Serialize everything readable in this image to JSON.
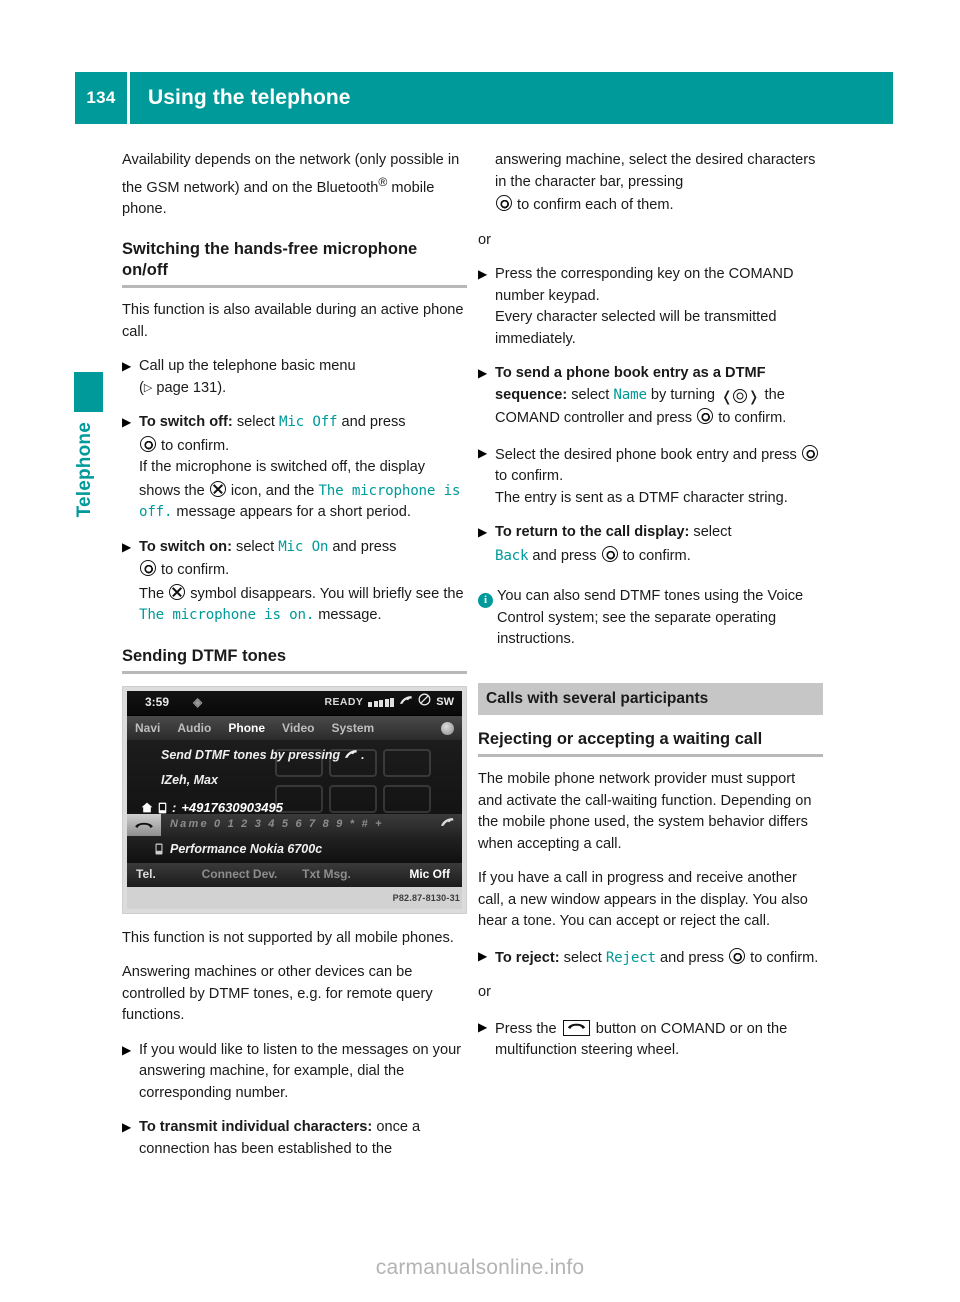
{
  "header": {
    "page_number": "134",
    "title": "Using the telephone"
  },
  "side_tab": {
    "label": "Telephone"
  },
  "left_column": {
    "intro_paragraph": "Availability depends on the network (only possible in the GSM network) and on the Bluetooth",
    "intro_paragraph_tail": " mobile phone.",
    "registered_mark": "®",
    "heading_mic": "Switching the hands-free microphone on/off",
    "mic_intro": "This function is also available during an active phone call.",
    "step_call_up": "Call up the telephone basic menu",
    "step_call_up_ref_open": "(",
    "step_call_up_ref": " page 131).",
    "step_switch_off_bold": "To switch off:",
    "step_switch_off_pre": " select ",
    "step_switch_off_code": "Mic Off",
    "step_switch_off_post": " and press ",
    "step_switch_off_confirm": " to confirm.",
    "switch_off_detail_1": "If the microphone is switched off, the display shows the ",
    "switch_off_detail_2": " icon, and the ",
    "switch_off_code_msg": "The microphone is off.",
    "switch_off_detail_3": " message appears for a short period.",
    "step_switch_on_bold": "To switch on:",
    "step_switch_on_pre": " select ",
    "step_switch_on_code": "Mic On",
    "step_switch_on_post": " and press ",
    "step_switch_on_confirm": " to confirm.",
    "switch_on_detail_1": "The ",
    "switch_on_detail_2": " symbol disappears. You will briefly see the ",
    "switch_on_code_msg": "The microphone is on.",
    "switch_on_detail_3": " message.",
    "heading_dtmf": "Sending DTMF tones",
    "after_shot_1": "This function is not supported by all mobile phones.",
    "after_shot_2": "Answering machines or other devices can be controlled by DTMF tones, e.g. for remote query functions.",
    "step_listen": "If you would like to listen to the messages on your answering machine, for example, dial the corresponding number.",
    "step_transmit_bold": "To transmit individual characters:",
    "step_transmit_rest": " once a connection has been established to the"
  },
  "comand_screenshot": {
    "status_time": "3:59",
    "status_globe_icon": "globe-icon",
    "status_ready": "READY",
    "status_signal_icon": "signal-bars-icon",
    "status_handset_icon": "handset-icon",
    "status_no_service_icon": "no-service-icon",
    "status_sw": "SW",
    "menu_items": [
      "Navi",
      "Audio",
      "Phone",
      "Video",
      "System"
    ],
    "menu_active": "Phone",
    "prompt_line": "Send DTMF tones by pressing",
    "prompt_line_end": ".",
    "contact_name": "IZeh, Max",
    "phone_number": "+4917630903495",
    "char_bar": "Name  0 1 2 3 4 5 6 7 8 9 * # +",
    "device_name": "Performance Nokia 6700c",
    "softkeys": [
      "Tel.",
      "Connect Dev.",
      "Txt Msg.",
      "Mic Off"
    ],
    "caption_code": "P82.87-8130-31"
  },
  "right_column": {
    "cont_1": "answering machine, select the desired characters in the character bar, pressing ",
    "cont_1_end": " to confirm each of them.",
    "or_1": "or",
    "step_press_key": "Press the corresponding key on the COMAND number keypad.",
    "step_press_key_detail": "Every character selected will be transmitted immediately.",
    "step_pb_bold": "To send a phone book entry as a DTMF sequence:",
    "step_pb_pre": " select ",
    "step_pb_code": "Name",
    "step_pb_mid": " by turning ",
    "step_pb_mid2": " the COMAND controller and press ",
    "step_pb_end": " to confirm.",
    "step_select_entry_1": "Select the desired phone book entry and press ",
    "step_select_entry_2": " to confirm.",
    "step_select_entry_detail": "The entry is sent as a DTMF character string.",
    "step_return_bold": "To return to the call display:",
    "step_return_pre": " select ",
    "step_return_code": "Back",
    "step_return_mid": " and press ",
    "step_return_end": " to confirm.",
    "note_text": "You can also send DTMF tones using the Voice Control system; see the separate operating instructions.",
    "band_heading": "Calls with several participants",
    "heading_waiting": "Rejecting or accepting a waiting call",
    "para_provider": "The mobile phone network provider must support and activate the call-waiting function. Depending on the mobile phone used, the system behavior differs when accepting a call.",
    "para_in_progress": "If you have a call in progress and receive another call, a new window appears in the display. You also hear a tone. You can accept or reject the call.",
    "step_reject_bold": "To reject:",
    "step_reject_pre": " select ",
    "step_reject_code": "Reject",
    "step_reject_mid": " and press ",
    "step_reject_end": " to confirm.",
    "or_2": "or",
    "step_press_button_pre": "Press the ",
    "step_press_button_post": " button on COMAND or on the multifunction steering wheel."
  },
  "watermark": "carmanualsonline.info",
  "colors": {
    "accent_teal": "#009a9a",
    "band_grey": "#c6c6c6",
    "rule_grey": "#b8b8b8"
  }
}
